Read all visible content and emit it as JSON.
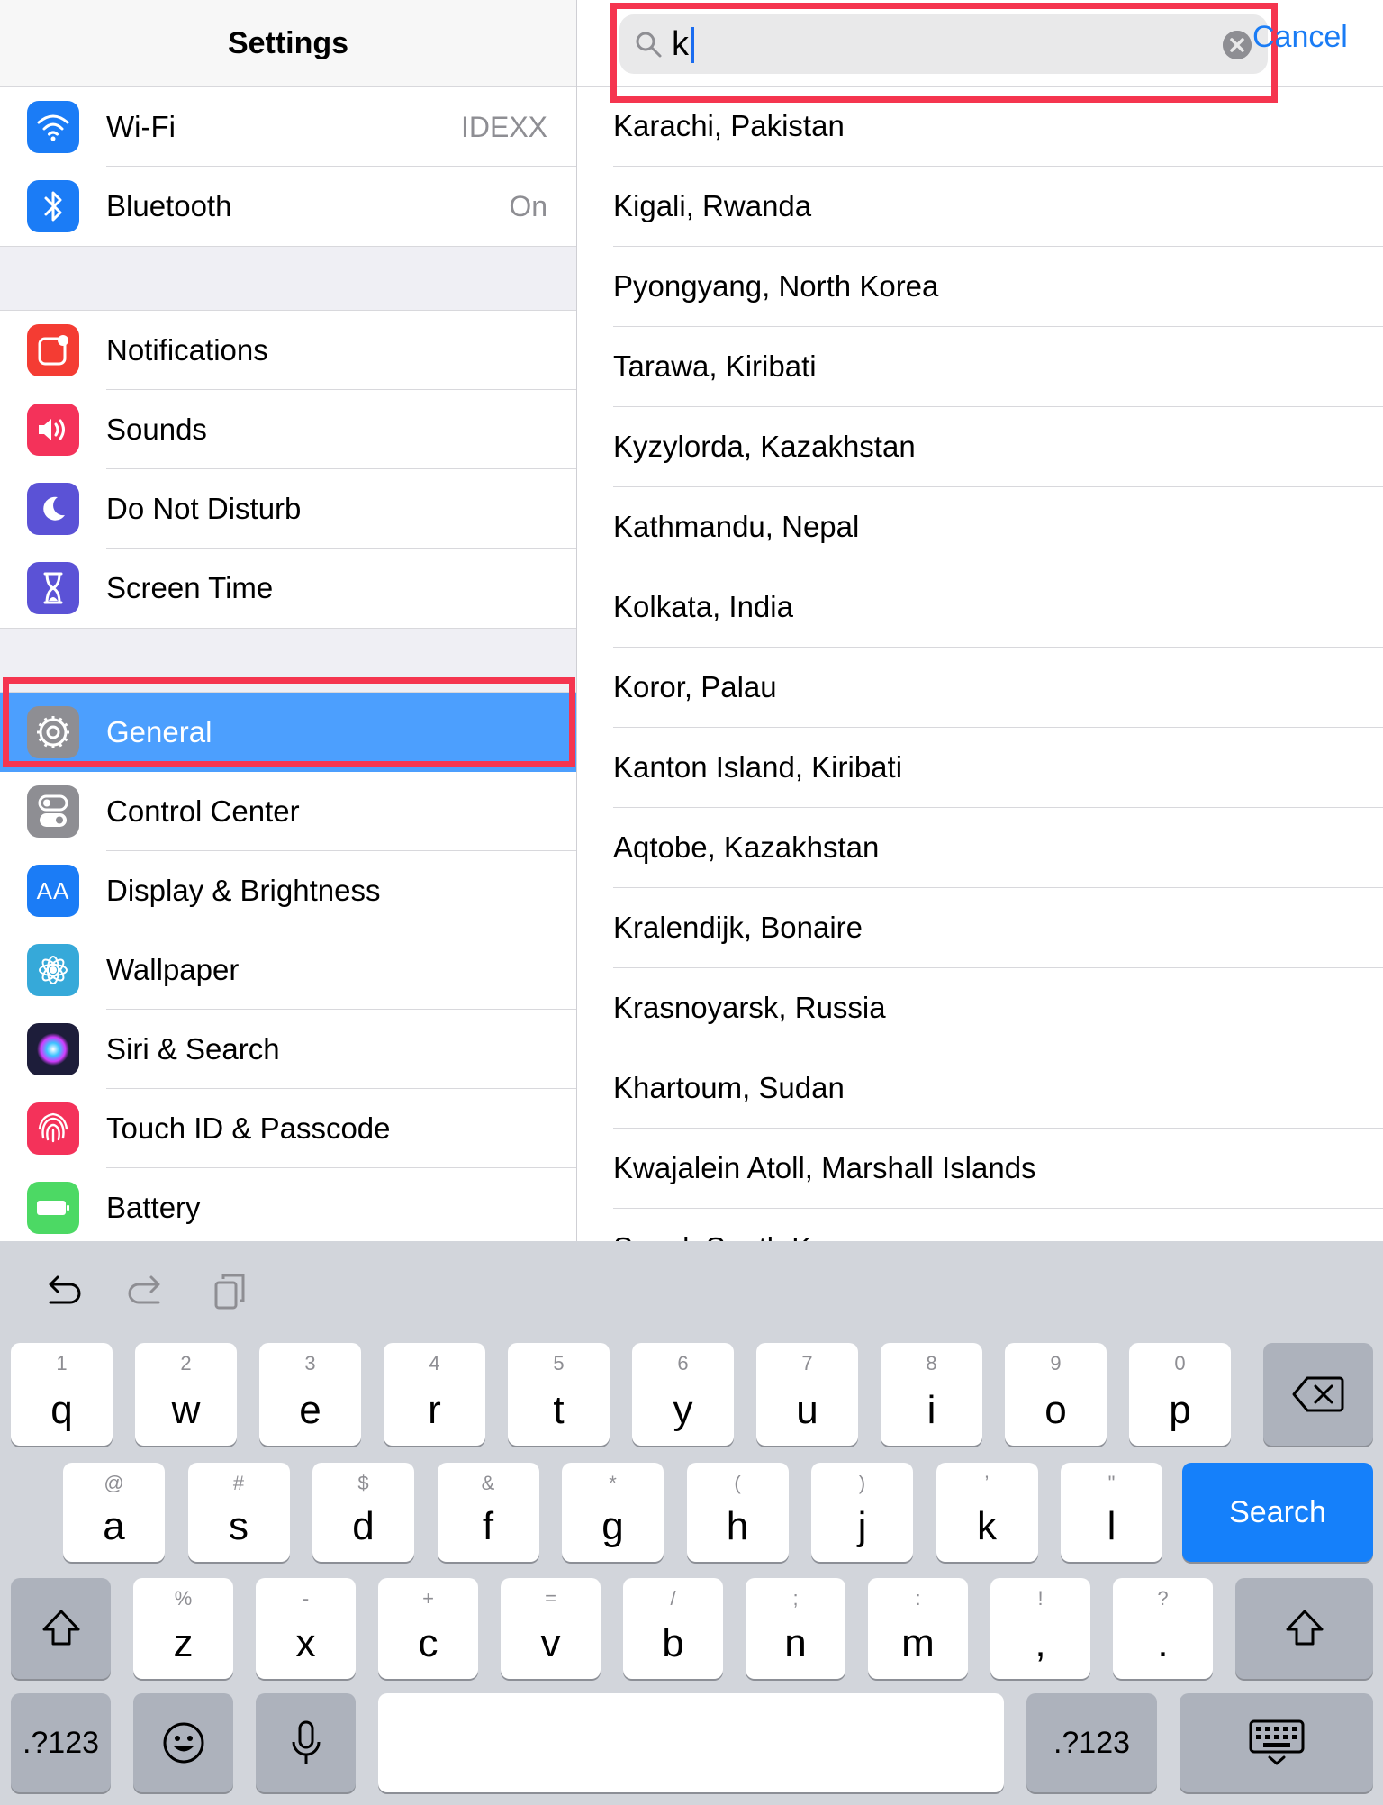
{
  "sidebar": {
    "title": "Settings",
    "group1": [
      {
        "label": "Wi-Fi",
        "value": "IDEXX",
        "icon": "wifi-icon",
        "color": "#1b7cf6"
      },
      {
        "label": "Bluetooth",
        "value": "On",
        "icon": "bluetooth-icon",
        "color": "#1b7cf6"
      }
    ],
    "group2": [
      {
        "label": "Notifications",
        "icon": "notifications-icon",
        "color": "#f43c33"
      },
      {
        "label": "Sounds",
        "icon": "speaker-icon",
        "color": "#f4325a"
      },
      {
        "label": "Do Not Disturb",
        "icon": "moon-icon",
        "color": "#5b52d6"
      },
      {
        "label": "Screen Time",
        "icon": "hourglass-icon",
        "color": "#5b52d6"
      }
    ],
    "group3": [
      {
        "label": "General",
        "icon": "gear-icon",
        "color": "#8e8e93",
        "selected": true
      },
      {
        "label": "Control Center",
        "icon": "toggles-icon",
        "color": "#8e8e93"
      },
      {
        "label": "Display & Brightness",
        "icon": "aa-icon",
        "icon_text": "AA",
        "color": "#1b7cf6"
      },
      {
        "label": "Wallpaper",
        "icon": "flower-icon",
        "color": "#36a9d9"
      },
      {
        "label": "Siri & Search",
        "icon": "siri-icon",
        "color": "#1d1d3a"
      },
      {
        "label": "Touch ID & Passcode",
        "icon": "fingerprint-icon",
        "color": "#f4325a"
      },
      {
        "label": "Battery",
        "icon": "battery-icon",
        "color": "#4cd964"
      }
    ]
  },
  "search": {
    "query": "k",
    "cancel_label": "Cancel"
  },
  "results": [
    "Karachi, Pakistan",
    "Kigali, Rwanda",
    "Pyongyang, North Korea",
    "Tarawa, Kiribati",
    "Kyzylorda, Kazakhstan",
    "Kathmandu, Nepal",
    "Kolkata, India",
    "Koror, Palau",
    "Kanton Island, Kiribati",
    "Aqtobe, Kazakhstan",
    "Kralendijk, Bonaire",
    "Krasnoyarsk, Russia",
    "Khartoum, Sudan",
    "Kwajalein Atoll, Marshall Islands",
    "Seoul, South Korea"
  ],
  "keyboard": {
    "row1": [
      {
        "main": "q",
        "alt": "1"
      },
      {
        "main": "w",
        "alt": "2"
      },
      {
        "main": "e",
        "alt": "3"
      },
      {
        "main": "r",
        "alt": "4"
      },
      {
        "main": "t",
        "alt": "5"
      },
      {
        "main": "y",
        "alt": "6"
      },
      {
        "main": "u",
        "alt": "7"
      },
      {
        "main": "i",
        "alt": "8"
      },
      {
        "main": "o",
        "alt": "9"
      },
      {
        "main": "p",
        "alt": "0"
      }
    ],
    "row2": [
      {
        "main": "a",
        "alt": "@"
      },
      {
        "main": "s",
        "alt": "#"
      },
      {
        "main": "d",
        "alt": "$"
      },
      {
        "main": "f",
        "alt": "&"
      },
      {
        "main": "g",
        "alt": "*"
      },
      {
        "main": "h",
        "alt": "("
      },
      {
        "main": "j",
        "alt": ")"
      },
      {
        "main": "k",
        "alt": "’"
      },
      {
        "main": "l",
        "alt": "\""
      }
    ],
    "row3": [
      {
        "main": "z",
        "alt": "%"
      },
      {
        "main": "x",
        "alt": "-"
      },
      {
        "main": "c",
        "alt": "+"
      },
      {
        "main": "v",
        "alt": "="
      },
      {
        "main": "b",
        "alt": "/"
      },
      {
        "main": "n",
        "alt": ";"
      },
      {
        "main": "m",
        "alt": ":"
      },
      {
        "main": ",",
        "alt": "!"
      },
      {
        "main": ".",
        "alt": "?"
      }
    ],
    "search_label": "Search",
    "numbers_label": ".?123"
  }
}
